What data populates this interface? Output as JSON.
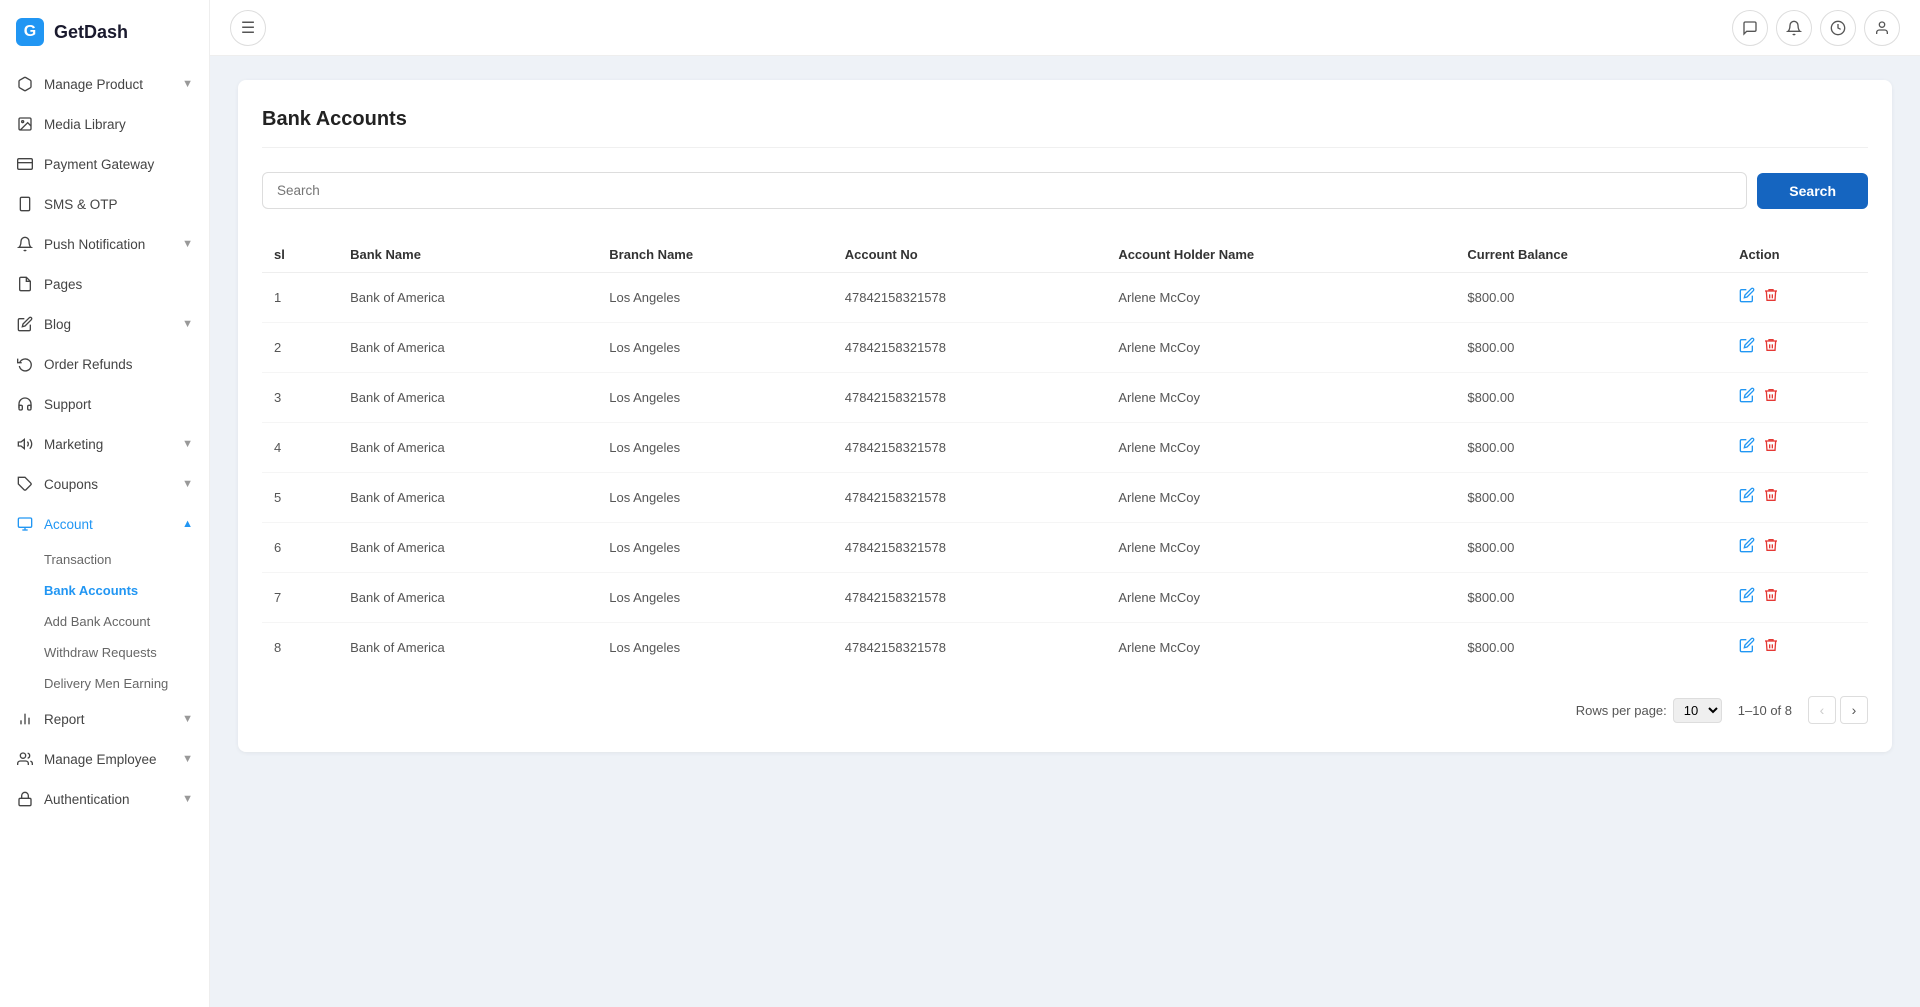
{
  "app": {
    "name": "GetDash",
    "logo_char": "G"
  },
  "sidebar": {
    "items": [
      {
        "id": "manage-product",
        "label": "Manage Product",
        "icon": "box",
        "has_children": true,
        "active": false
      },
      {
        "id": "media-library",
        "label": "Media Library",
        "icon": "image",
        "has_children": false,
        "active": false
      },
      {
        "id": "payment-gateway",
        "label": "Payment Gateway",
        "icon": "credit-card",
        "has_children": false,
        "active": false
      },
      {
        "id": "sms-otp",
        "label": "SMS & OTP",
        "icon": "phone",
        "has_children": false,
        "active": false
      },
      {
        "id": "push-notification",
        "label": "Push Notification",
        "icon": "bell",
        "has_children": true,
        "active": false
      },
      {
        "id": "pages",
        "label": "Pages",
        "icon": "file",
        "has_children": false,
        "active": false
      },
      {
        "id": "blog",
        "label": "Blog",
        "icon": "edit",
        "has_children": true,
        "active": false
      },
      {
        "id": "order-refunds",
        "label": "Order Refunds",
        "icon": "refresh",
        "has_children": false,
        "active": false
      },
      {
        "id": "support",
        "label": "Support",
        "icon": "headset",
        "has_children": false,
        "active": false
      },
      {
        "id": "marketing",
        "label": "Marketing",
        "icon": "megaphone",
        "has_children": true,
        "active": false
      },
      {
        "id": "coupons",
        "label": "Coupons",
        "icon": "tag",
        "has_children": true,
        "active": false
      },
      {
        "id": "account",
        "label": "Account",
        "icon": "account",
        "has_children": true,
        "active": true
      },
      {
        "id": "report",
        "label": "Report",
        "icon": "chart",
        "has_children": true,
        "active": false
      },
      {
        "id": "manage-employee",
        "label": "Manage Employee",
        "icon": "users",
        "has_children": true,
        "active": false
      },
      {
        "id": "authentication",
        "label": "Authentication",
        "icon": "lock",
        "has_children": true,
        "active": false
      }
    ],
    "account_sub_items": [
      {
        "id": "transaction",
        "label": "Transaction",
        "active": false
      },
      {
        "id": "bank-accounts",
        "label": "Bank Accounts",
        "active": true
      },
      {
        "id": "add-bank-account",
        "label": "Add Bank Account",
        "active": false
      },
      {
        "id": "withdraw-requests",
        "label": "Withdraw Requests",
        "active": false
      },
      {
        "id": "delivery-men-earning",
        "label": "Delivery Men Earning",
        "active": false
      }
    ]
  },
  "topbar": {
    "menu_icon": "☰",
    "icons": [
      "💬",
      "🔔",
      "🕐",
      "👤"
    ]
  },
  "page": {
    "title": "Bank Accounts",
    "search_placeholder": "Search",
    "search_button_label": "Search"
  },
  "table": {
    "columns": [
      "sl",
      "Bank Name",
      "Branch Name",
      "Account No",
      "Account Holder Name",
      "Current Balance",
      "Action"
    ],
    "rows": [
      {
        "sl": 1,
        "bank_name": "Bank of America",
        "branch_name": "Los Angeles",
        "account_no": "47842158321578",
        "account_holder": "Arlene McCoy",
        "balance": "$800.00"
      },
      {
        "sl": 2,
        "bank_name": "Bank of America",
        "branch_name": "Los Angeles",
        "account_no": "47842158321578",
        "account_holder": "Arlene McCoy",
        "balance": "$800.00"
      },
      {
        "sl": 3,
        "bank_name": "Bank of America",
        "branch_name": "Los Angeles",
        "account_no": "47842158321578",
        "account_holder": "Arlene McCoy",
        "balance": "$800.00"
      },
      {
        "sl": 4,
        "bank_name": "Bank of America",
        "branch_name": "Los Angeles",
        "account_no": "47842158321578",
        "account_holder": "Arlene McCoy",
        "balance": "$800.00"
      },
      {
        "sl": 5,
        "bank_name": "Bank of America",
        "branch_name": "Los Angeles",
        "account_no": "47842158321578",
        "account_holder": "Arlene McCoy",
        "balance": "$800.00"
      },
      {
        "sl": 6,
        "bank_name": "Bank of America",
        "branch_name": "Los Angeles",
        "account_no": "47842158321578",
        "account_holder": "Arlene McCoy",
        "balance": "$800.00"
      },
      {
        "sl": 7,
        "bank_name": "Bank of America",
        "branch_name": "Los Angeles",
        "account_no": "47842158321578",
        "account_holder": "Arlene McCoy",
        "balance": "$800.00"
      },
      {
        "sl": 8,
        "bank_name": "Bank of America",
        "branch_name": "Los Angeles",
        "account_no": "47842158321578",
        "account_holder": "Arlene McCoy",
        "balance": "$800.00"
      }
    ]
  },
  "pagination": {
    "rows_per_page_label": "Rows per page:",
    "rows_per_page_value": "10",
    "range_label": "1–10 of 8",
    "prev_disabled": true,
    "next_disabled": false
  }
}
